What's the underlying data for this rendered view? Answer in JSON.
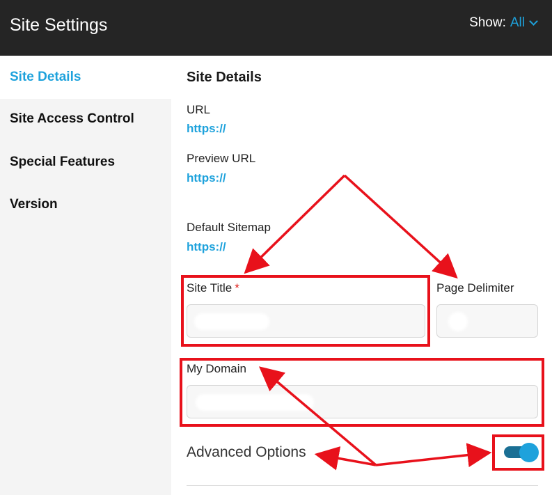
{
  "header": {
    "title": "Site Settings",
    "show_label": "Show:",
    "show_value": "All"
  },
  "sidebar": {
    "items": [
      {
        "label": "Site Details",
        "active": true
      },
      {
        "label": "Site Access Control",
        "active": false
      },
      {
        "label": "Special Features",
        "active": false
      },
      {
        "label": "Version",
        "active": false
      }
    ]
  },
  "main": {
    "section_title": "Site Details",
    "url": {
      "label": "URL",
      "value": "https://"
    },
    "preview_url": {
      "label": "Preview URL",
      "value": "https://"
    },
    "default_sitemap": {
      "label": "Default Sitemap",
      "value": "https://"
    },
    "site_title": {
      "label": "Site Title",
      "required_mark": "*",
      "value": ""
    },
    "page_delimiter": {
      "label": "Page Delimiter",
      "value": ""
    },
    "my_domain": {
      "label": "My Domain",
      "value": ""
    },
    "advanced_options": {
      "label": "Advanced Options",
      "enabled": true
    }
  },
  "colors": {
    "header_bg": "#252525",
    "accent": "#1ea2dc",
    "annotation": "#e8111b",
    "sidebar_bg": "#f4f4f4"
  }
}
